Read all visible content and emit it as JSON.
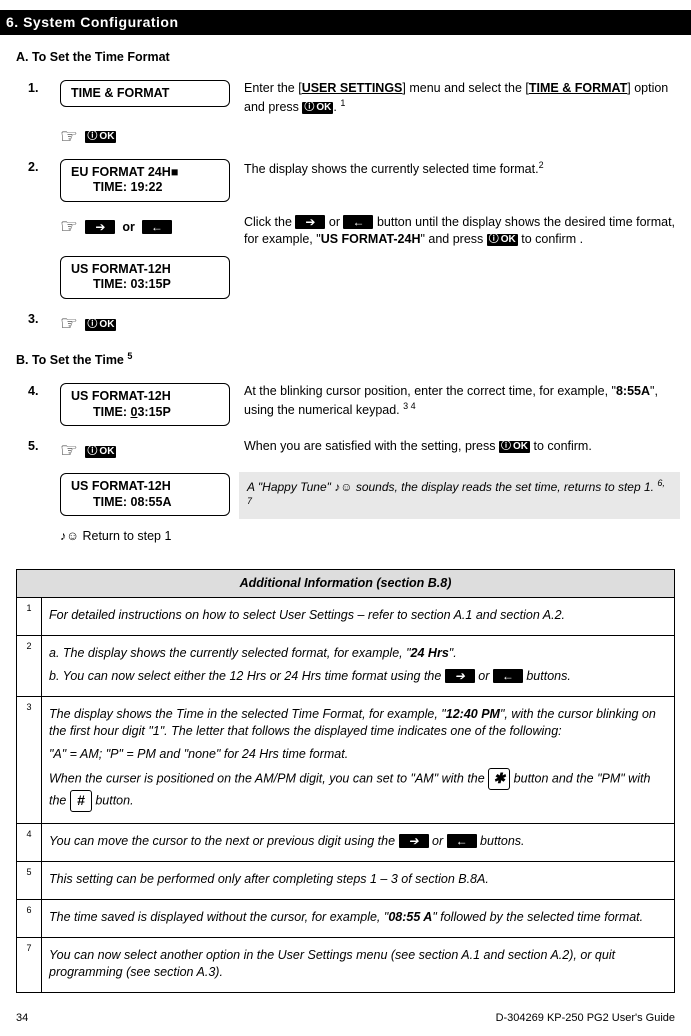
{
  "header": {
    "title": "6. System Configuration"
  },
  "sectionA": {
    "title": "A. To Set the Time Format",
    "steps": {
      "s1": {
        "num": "1.",
        "lcd": {
          "l1": "TIME & FORMAT"
        },
        "textParts": {
          "a": "Enter the [",
          "b": "USER SETTINGS",
          "c": "] menu and select the [",
          "d": "TIME & FORMAT",
          "e": "] option and press ",
          "f": ".",
          "sup": "1"
        }
      },
      "s2": {
        "num": "2.",
        "lcd1": {
          "l1": "EU FORMAT 24H■",
          "l2": "TIME: 19:22"
        },
        "text1": "The display shows the currently selected time format.",
        "sup1": "2",
        "orLabel": "or",
        "lcd2": {
          "l1": "US FORMAT-12H",
          "l2": "TIME: 03:15P"
        },
        "text2a": "Click the ",
        "text2b": " or ",
        "text2c": " button until the display shows the desired time format, for example, \"",
        "text2d": "US FORMAT-24H",
        "text2e": "\" and press ",
        "text2f": " to confirm ."
      },
      "s3": {
        "num": "3."
      }
    }
  },
  "sectionB": {
    "title": "B. To Set the Time ",
    "sup": "5",
    "steps": {
      "s4": {
        "num": "4.",
        "lcd": {
          "l1": "US FORMAT-12H",
          "l2a": "TIME: ",
          "l2b": "0",
          "l2c": "3:15P"
        },
        "text1": "At the blinking cursor position, enter the correct time, for example, \"",
        "text2": "8:55A",
        "text3": "\", using the numerical keypad.",
        "sup": "3  4"
      },
      "s5": {
        "num": "5.",
        "text1": "When you are satisfied with the setting, press ",
        "text2": " to confirm.",
        "lcd": {
          "l1": "US FORMAT-12H",
          "l2": "TIME: 08:55A"
        },
        "happy1": "A \"Happy Tune\" ♪☺ sounds, the display reads the set time, returns to step 1.",
        "happySup": "6, 7",
        "return": "♪☺ Return to step 1"
      }
    }
  },
  "keys": {
    "ok": "OK",
    "info": "ⓘ",
    "right": "➔",
    "left": "←",
    "star": "✱",
    "hash": "#"
  },
  "addl": {
    "header": "Additional Information (section B.8)",
    "rows": [
      {
        "ref": "1",
        "paras": [
          "For detailed instructions on how to select User Settings – refer to section A.1 and section A.2."
        ]
      },
      {
        "ref": "2"
      },
      {
        "ref": "3"
      },
      {
        "ref": "4"
      },
      {
        "ref": "5",
        "paras": [
          "This setting can be performed only after completing steps 1 – 3 of section B.8A."
        ]
      },
      {
        "ref": "6"
      },
      {
        "ref": "7",
        "paras": [
          "You can now select another option in the User Settings menu (see section A.1 and section A.2), or quit programming (see section A.3)."
        ]
      }
    ],
    "row2": {
      "a1": "a. The display shows the currently selected format, for example, \"",
      "a2": "24 Hrs",
      "a3": "\".",
      "b1": "b. You can now select either the 12 Hrs or 24 Hrs time format using the ",
      "b2": " or ",
      "b3": " buttons."
    },
    "row3": {
      "p1a": "The display shows the Time in the selected Time Format, for example, \"",
      "p1b": "12:40 PM",
      "p1c": "\", with the cursor blinking on the first hour digit \"1\". The letter that follows the displayed time indicates one of the following:",
      "p2": "\"A\" = AM; \"P\" = PM and \"none\" for 24 Hrs time format.",
      "p3a": "When the curser is positioned on the AM/PM digit, you can set to \"AM\" with the ",
      "p3b": " button and the \"PM\" with the ",
      "p3c": " button."
    },
    "row4": {
      "a": "You can move the cursor to the next or previous digit using the ",
      "b": " or ",
      "c": " buttons."
    },
    "row6": {
      "a": "The time saved is displayed without the cursor, for example, \"",
      "b": "08:55 A",
      "c": "\" followed by the selected time format."
    }
  },
  "footer": {
    "page": "34",
    "guide": "D-304269 KP-250 PG2 User's Guide"
  }
}
